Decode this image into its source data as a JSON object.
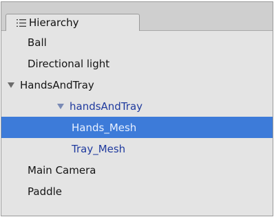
{
  "panel": {
    "tab_label": "Hierarchy",
    "tab_icon": "list-icon"
  },
  "items": [
    {
      "label": "Ball",
      "depth": 0,
      "expanded": false,
      "selected": false,
      "prefab": false
    },
    {
      "label": "Directional light",
      "depth": 0,
      "expanded": false,
      "selected": false,
      "prefab": false
    },
    {
      "label": "HandsAndTray",
      "depth": 0,
      "expanded": true,
      "selected": false,
      "prefab": false
    },
    {
      "label": "handsAndTray",
      "depth": 1,
      "expanded": true,
      "selected": false,
      "prefab": true
    },
    {
      "label": "Hands_Mesh",
      "depth": 2,
      "expanded": false,
      "selected": true,
      "prefab": true
    },
    {
      "label": "Tray_Mesh",
      "depth": 2,
      "expanded": false,
      "selected": false,
      "prefab": true
    },
    {
      "label": "Main Camera",
      "depth": 0,
      "expanded": false,
      "selected": false,
      "prefab": false
    },
    {
      "label": "Paddle",
      "depth": 0,
      "expanded": false,
      "selected": false,
      "prefab": false
    }
  ],
  "colors": {
    "panel_bg": "#e4e4e4",
    "selection_bg": "#3d7bd9",
    "prefab_text": "#1f3a9e",
    "text": "#141414"
  }
}
